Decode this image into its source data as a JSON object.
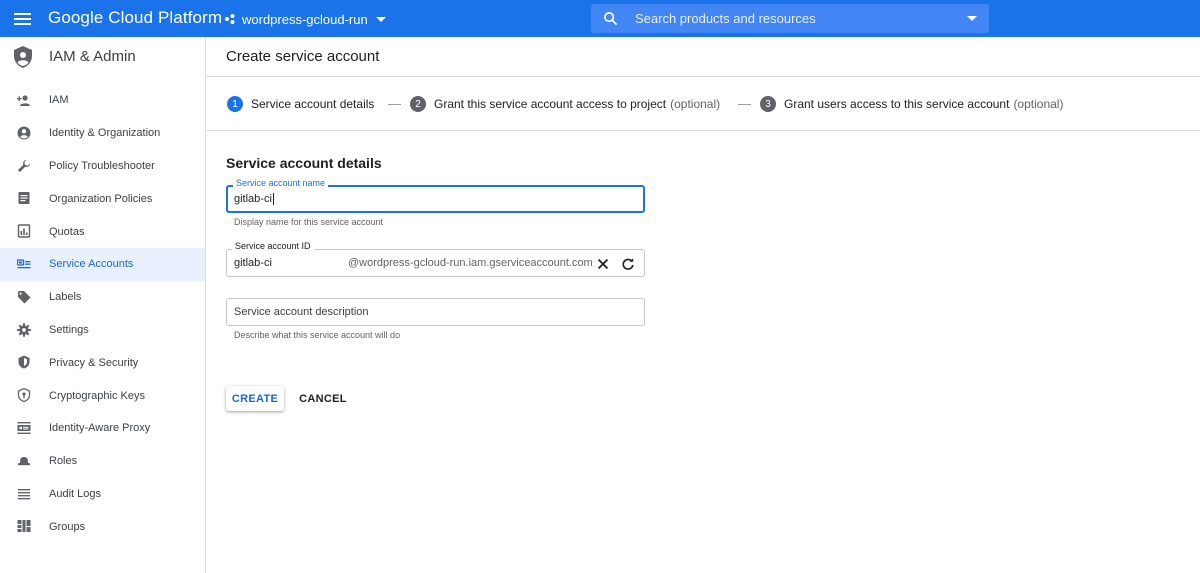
{
  "topbar": {
    "menu_icon": "hamburger-menu-icon",
    "brand": "Google Cloud Platform",
    "project": "wordpress-gcloud-run",
    "search_placeholder": "Search products and resources",
    "color": "#1a73e8"
  },
  "sidebar": {
    "title": "IAM & Admin",
    "items": [
      {
        "label": "IAM",
        "icon": "person-add-icon"
      },
      {
        "label": "Identity & Organization",
        "icon": "account-circle-icon"
      },
      {
        "label": "Policy Troubleshooter",
        "icon": "wrench-icon"
      },
      {
        "label": "Organization Policies",
        "icon": "list-document-icon"
      },
      {
        "label": "Quotas",
        "icon": "quota-icon"
      },
      {
        "label": "Service Accounts",
        "icon": "service-account-icon",
        "active": true
      },
      {
        "label": "Labels",
        "icon": "label-tag-icon"
      },
      {
        "label": "Settings",
        "icon": "gear-icon"
      },
      {
        "label": "Privacy & Security",
        "icon": "shield-icon"
      },
      {
        "label": "Cryptographic Keys",
        "icon": "key-shield-icon"
      },
      {
        "label": "Identity-Aware Proxy",
        "icon": "proxy-icon"
      },
      {
        "label": "Roles",
        "icon": "hat-icon"
      },
      {
        "label": "Audit Logs",
        "icon": "lines-icon"
      },
      {
        "label": "Groups",
        "icon": "groups-icon"
      }
    ]
  },
  "main": {
    "title": "Create service account",
    "steps": [
      {
        "num": "1",
        "label": "Service account details",
        "optional": ""
      },
      {
        "num": "2",
        "label": "Grant this service account access to project",
        "optional": "(optional)"
      },
      {
        "num": "3",
        "label": "Grant users access to this service account",
        "optional": "(optional)"
      }
    ],
    "section_title": "Service account details",
    "name_field": {
      "label": "Service account name",
      "value": "gitlab-ci",
      "hint": "Display name for this service account"
    },
    "id_field": {
      "label": "Service account ID",
      "value": "gitlab-ci",
      "suffix": "@wordpress-gcloud-run.iam.gserviceaccount.com"
    },
    "description_field": {
      "placeholder": "Service account description",
      "hint": "Describe what this service account will do"
    },
    "create_label": "CREATE",
    "cancel_label": "CANCEL"
  }
}
